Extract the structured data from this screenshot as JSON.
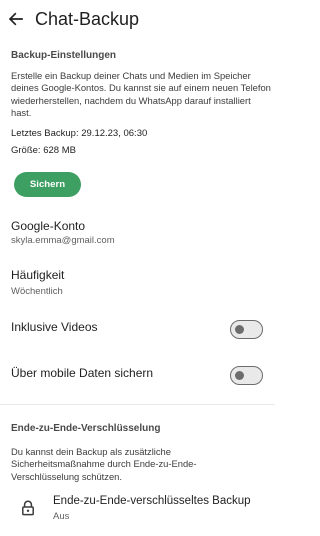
{
  "header": {
    "title": "Chat-Backup"
  },
  "backup_settings": {
    "section_title": "Backup-Einstellungen",
    "description": "Erstelle ein Backup deiner Chats und Medien im Speicher deines Google-Kontos. Du kannst sie auf einem neuen Telefon wiederherstellen, nachdem du WhatsApp darauf installiert hast.",
    "last_backup": "Letztes Backup: 29.12.23, 06:30",
    "size": "Größe: 628 MB",
    "backup_button": "Sichern"
  },
  "google_account": {
    "title": "Google-Konto",
    "value": "skyla.emma@gmail.com"
  },
  "frequency": {
    "title": "Häufigkeit",
    "value": "Wöchentlich"
  },
  "include_videos": {
    "title": "Inklusive Videos",
    "enabled": false
  },
  "mobile_data": {
    "title": "Über mobile Daten sichern",
    "enabled": false
  },
  "e2e": {
    "section_title": "Ende-zu-Ende-Verschlüsselung",
    "description": "Du kannst dein Backup als zusätzliche Sicherheitsmaßnahme durch Ende-zu-Ende-Verschlüsselung schützen.",
    "item_title": "Ende-zu-Ende-verschlüsseltes Backup",
    "item_status": "Aus"
  },
  "colors": {
    "accent": "#3d9f62",
    "toggle_off": "#6c6c6c"
  }
}
